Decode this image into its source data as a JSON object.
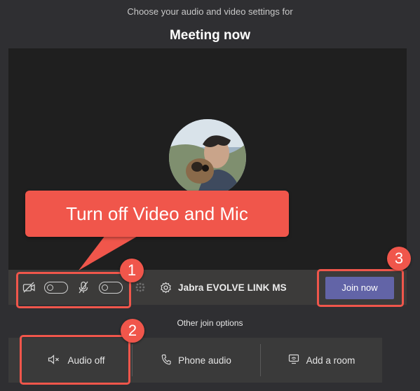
{
  "header": {
    "subtitle": "Choose your audio and video settings for",
    "meeting_title": "Meeting now"
  },
  "preview": {
    "avatar_icon": "user-photo"
  },
  "controls": {
    "video_toggle_state": "off",
    "mic_toggle_state": "off",
    "device_name": "Jabra EVOLVE LINK MS",
    "join_label": "Join now"
  },
  "join_options": {
    "heading": "Other join options",
    "items": [
      {
        "label": "Audio off",
        "icon": "speaker-muted-icon"
      },
      {
        "label": "Phone audio",
        "icon": "phone-icon"
      },
      {
        "label": "Add a room",
        "icon": "room-display-icon"
      }
    ]
  },
  "annotations": {
    "callout_text": "Turn off Video and Mic",
    "badges": [
      "1",
      "2",
      "3"
    ],
    "accent_color": "#f0564b"
  },
  "colors": {
    "background": "#2f2f32",
    "join_button": "#6264a7"
  }
}
